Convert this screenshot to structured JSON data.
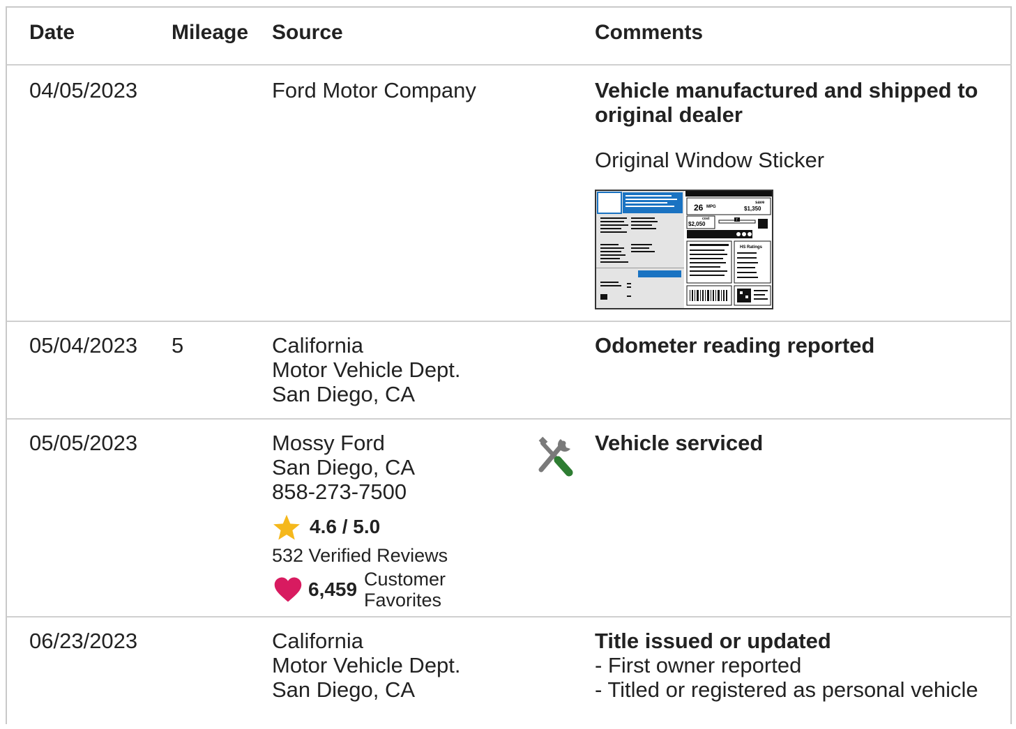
{
  "headers": {
    "date": "Date",
    "mileage": "Mileage",
    "source": "Source",
    "comments": "Comments"
  },
  "rows": [
    {
      "date": "04/05/2023",
      "mileage": "",
      "source": [
        "Ford Motor Company"
      ],
      "comment_title": "Vehicle manufactured and shipped to original dealer",
      "sticker_link": "Original Window Sticker",
      "sticker_image": {
        "mpg": "26",
        "mpg_unit": "MPG",
        "save": "save",
        "save_value": "$1,350",
        "cost_label": "cost",
        "cost_value": "$2,050",
        "ratings_label": "HS Ratings",
        "scale_value": "7"
      }
    },
    {
      "date": "05/04/2023",
      "mileage": "5",
      "source": [
        "California",
        "Motor Vehicle Dept.",
        "San Diego, CA"
      ],
      "comment_title": "Odometer reading reported"
    },
    {
      "date": "05/05/2023",
      "mileage": "",
      "source": [
        "Mossy Ford",
        "San Diego, CA",
        "858-273-7500"
      ],
      "comment_title": "Vehicle serviced",
      "icon": "wrench-screwdriver-icon",
      "rating": "4.6 / 5.0",
      "reviews": "532 Verified Reviews",
      "favorites_count": "6,459",
      "favorites_label_1": "Customer",
      "favorites_label_2": "Favorites",
      "colors": {
        "star": "#f5b81c",
        "heart": "#d81b60",
        "screwdriver": "#2e7d32"
      }
    },
    {
      "date": "06/23/2023",
      "mileage": "",
      "source": [
        "California",
        "Motor Vehicle Dept.",
        "San Diego, CA"
      ],
      "comment_title": "Title issued or updated",
      "comment_items": [
        "- First owner reported",
        "- Titled or registered as personal vehicle"
      ]
    }
  ]
}
